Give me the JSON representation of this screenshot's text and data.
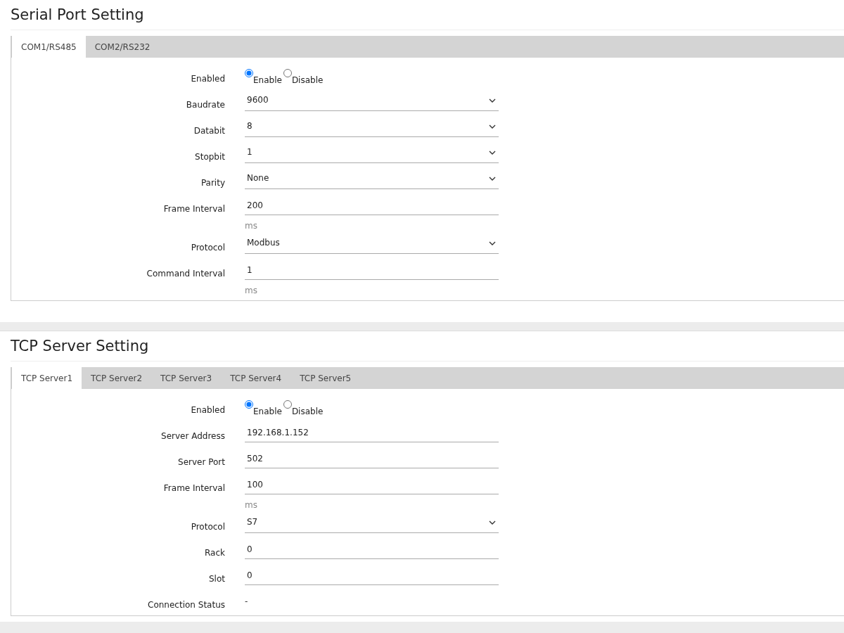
{
  "sections": [
    {
      "title": "Serial Port Setting",
      "tabs": [
        {
          "label": "COM1/RS485",
          "selected": true
        },
        {
          "label": "COM2/RS232",
          "selected": false
        }
      ],
      "fields": [
        {
          "kind": "radio",
          "label": "Enabled",
          "options": [
            {
              "label": "Enable",
              "selected": true
            },
            {
              "label": "Disable",
              "selected": false
            }
          ]
        },
        {
          "kind": "select",
          "label": "Baudrate",
          "value": "9600"
        },
        {
          "kind": "select",
          "label": "Databit",
          "value": "8"
        },
        {
          "kind": "select",
          "label": "Stopbit",
          "value": "1"
        },
        {
          "kind": "select",
          "label": "Parity",
          "value": "None"
        },
        {
          "kind": "input",
          "label": "Frame Interval",
          "value": "200",
          "unit": "ms"
        },
        {
          "kind": "select",
          "label": "Protocol",
          "value": "Modbus"
        },
        {
          "kind": "input",
          "label": "Command Interval",
          "value": "1",
          "unit": "ms"
        }
      ]
    },
    {
      "title": "TCP Server Setting",
      "tabs": [
        {
          "label": "TCP Server1",
          "selected": true
        },
        {
          "label": "TCP Server2",
          "selected": false
        },
        {
          "label": "TCP Server3",
          "selected": false
        },
        {
          "label": "TCP Server4",
          "selected": false
        },
        {
          "label": "TCP Server5",
          "selected": false
        }
      ],
      "fields": [
        {
          "kind": "radio",
          "label": "Enabled",
          "options": [
            {
              "label": "Enable",
              "selected": true
            },
            {
              "label": "Disable",
              "selected": false
            }
          ]
        },
        {
          "kind": "input",
          "label": "Server Address",
          "value": "192.168.1.152"
        },
        {
          "kind": "input",
          "label": "Server Port",
          "value": "502"
        },
        {
          "kind": "input",
          "label": "Frame Interval",
          "value": "100",
          "unit": "ms"
        },
        {
          "kind": "select",
          "label": "Protocol",
          "value": "S7"
        },
        {
          "kind": "input",
          "label": "Rack",
          "value": "0"
        },
        {
          "kind": "input",
          "label": "Slot",
          "value": "0"
        },
        {
          "kind": "text",
          "label": "Connection Status",
          "value": "-"
        }
      ]
    }
  ]
}
